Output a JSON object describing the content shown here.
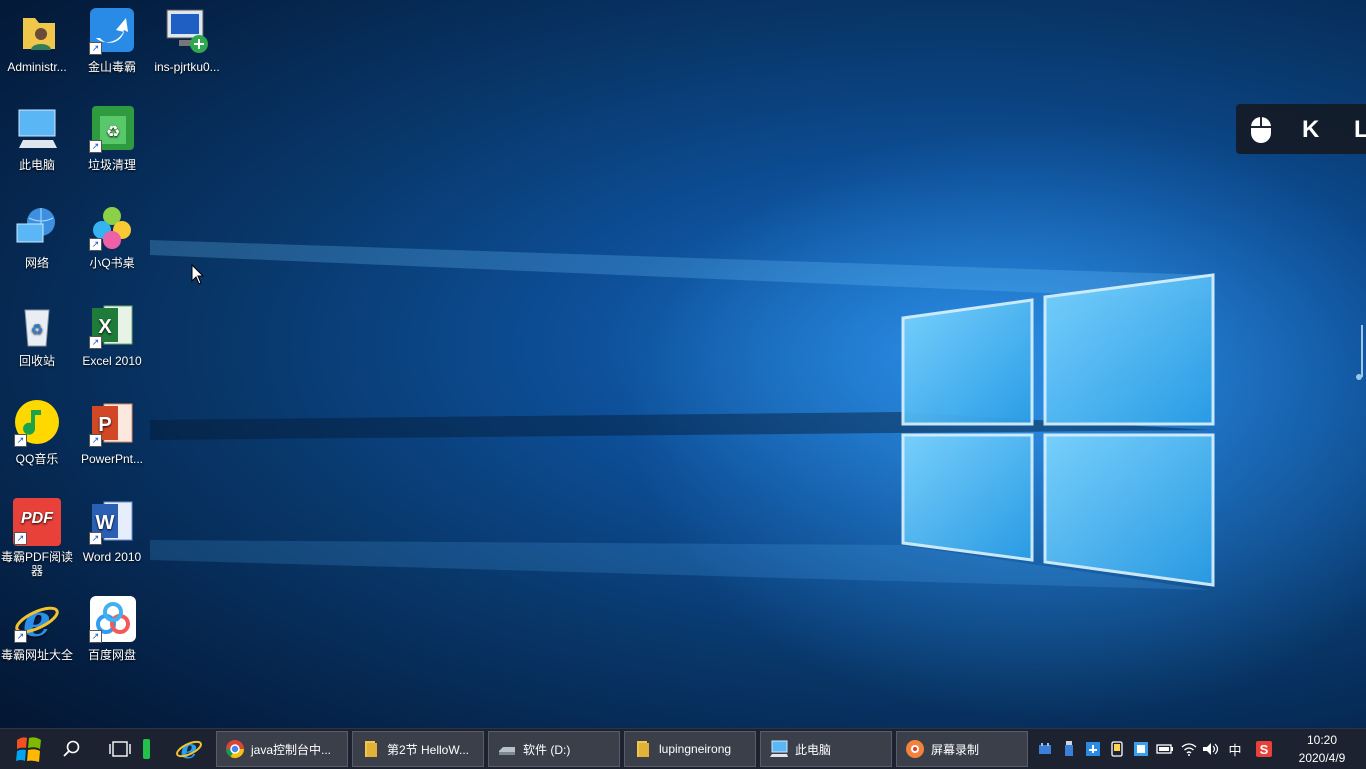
{
  "desktop": {
    "icons": [
      {
        "label": "Administr...",
        "icon": "user-folder-icon"
      },
      {
        "label": "金山毒霸",
        "icon": "kingsoft-antivirus-icon"
      },
      {
        "label": "ins-pjrtku0...",
        "icon": "remote-desktop-icon"
      },
      {
        "label": "此电脑",
        "icon": "this-pc-icon"
      },
      {
        "label": "垃圾清理",
        "icon": "trash-cleaner-icon"
      },
      {
        "label": "网络",
        "icon": "network-icon"
      },
      {
        "label": "小Q书桌",
        "icon": "xiaoq-desktop-icon"
      },
      {
        "label": "回收站",
        "icon": "recycle-bin-icon"
      },
      {
        "label": "Excel 2010",
        "icon": "excel-icon"
      },
      {
        "label": "QQ音乐",
        "icon": "qq-music-icon"
      },
      {
        "label": "PowerPnt...",
        "icon": "powerpoint-icon"
      },
      {
        "label": "毒霸PDF阅读器",
        "icon": "pdf-reader-icon"
      },
      {
        "label": "Word 2010",
        "icon": "word-icon"
      },
      {
        "label": "毒霸网址大全",
        "icon": "ie-browser-icon"
      },
      {
        "label": "百度网盘",
        "icon": "baidu-netdisk-icon"
      }
    ],
    "pdf_badge": "PDF"
  },
  "floating_bar": {
    "keys": [
      "K",
      "L"
    ]
  },
  "taskbar": {
    "tasks": [
      {
        "label": "java控制台中...",
        "icon": "chrome-icon"
      },
      {
        "label": "第2节 HelloW...",
        "icon": "folder-icon"
      },
      {
        "label": "软件 (D:)",
        "icon": "drive-icon"
      },
      {
        "label": "lupingneirong",
        "icon": "folder-icon"
      },
      {
        "label": "此电脑",
        "icon": "this-pc-icon"
      },
      {
        "label": "屏幕录制",
        "icon": "screen-recorder-icon"
      }
    ],
    "ime": "中",
    "clock": {
      "time": "10:20",
      "date": "2020/4/9"
    }
  },
  "colors": {
    "taskbar": "#1c2230",
    "task_active": "#3a3f4a",
    "accent": "#3aa6ff"
  }
}
